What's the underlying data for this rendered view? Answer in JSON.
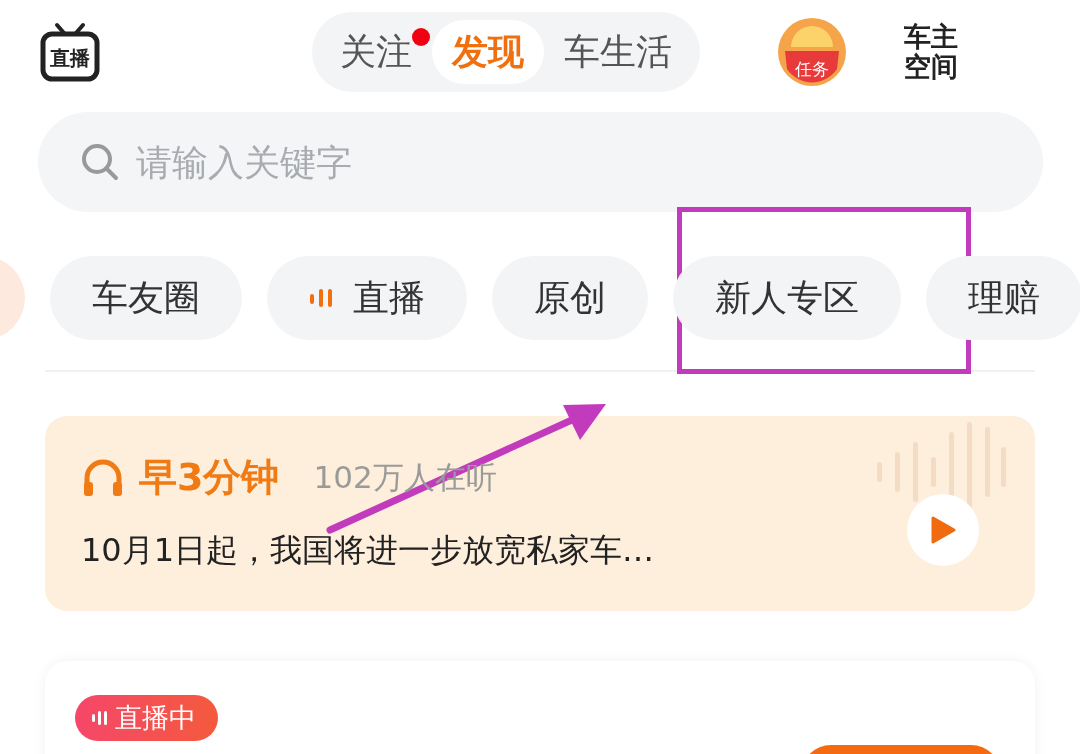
{
  "header": {
    "live_label": "直播",
    "tabs": [
      {
        "label": "关注",
        "selected": false,
        "badge": true
      },
      {
        "label": "发现",
        "selected": true,
        "badge": false
      },
      {
        "label": "车生活",
        "selected": false,
        "badge": false
      }
    ],
    "task_label": "任务",
    "owner_space": "车主空间"
  },
  "search": {
    "placeholder": "请输入关键字"
  },
  "chips": [
    {
      "label": "车友圈",
      "kind": "text"
    },
    {
      "label": "直播",
      "kind": "live"
    },
    {
      "label": "原创",
      "kind": "text"
    },
    {
      "label": "新人专区",
      "kind": "text"
    },
    {
      "label": "理赔",
      "kind": "text"
    }
  ],
  "audio_card": {
    "title": "早3分钟",
    "listeners": "102万人在听",
    "headline": "10月1日起，我国将进一步放宽私家车…"
  },
  "live_card": {
    "tag": "直播中"
  }
}
